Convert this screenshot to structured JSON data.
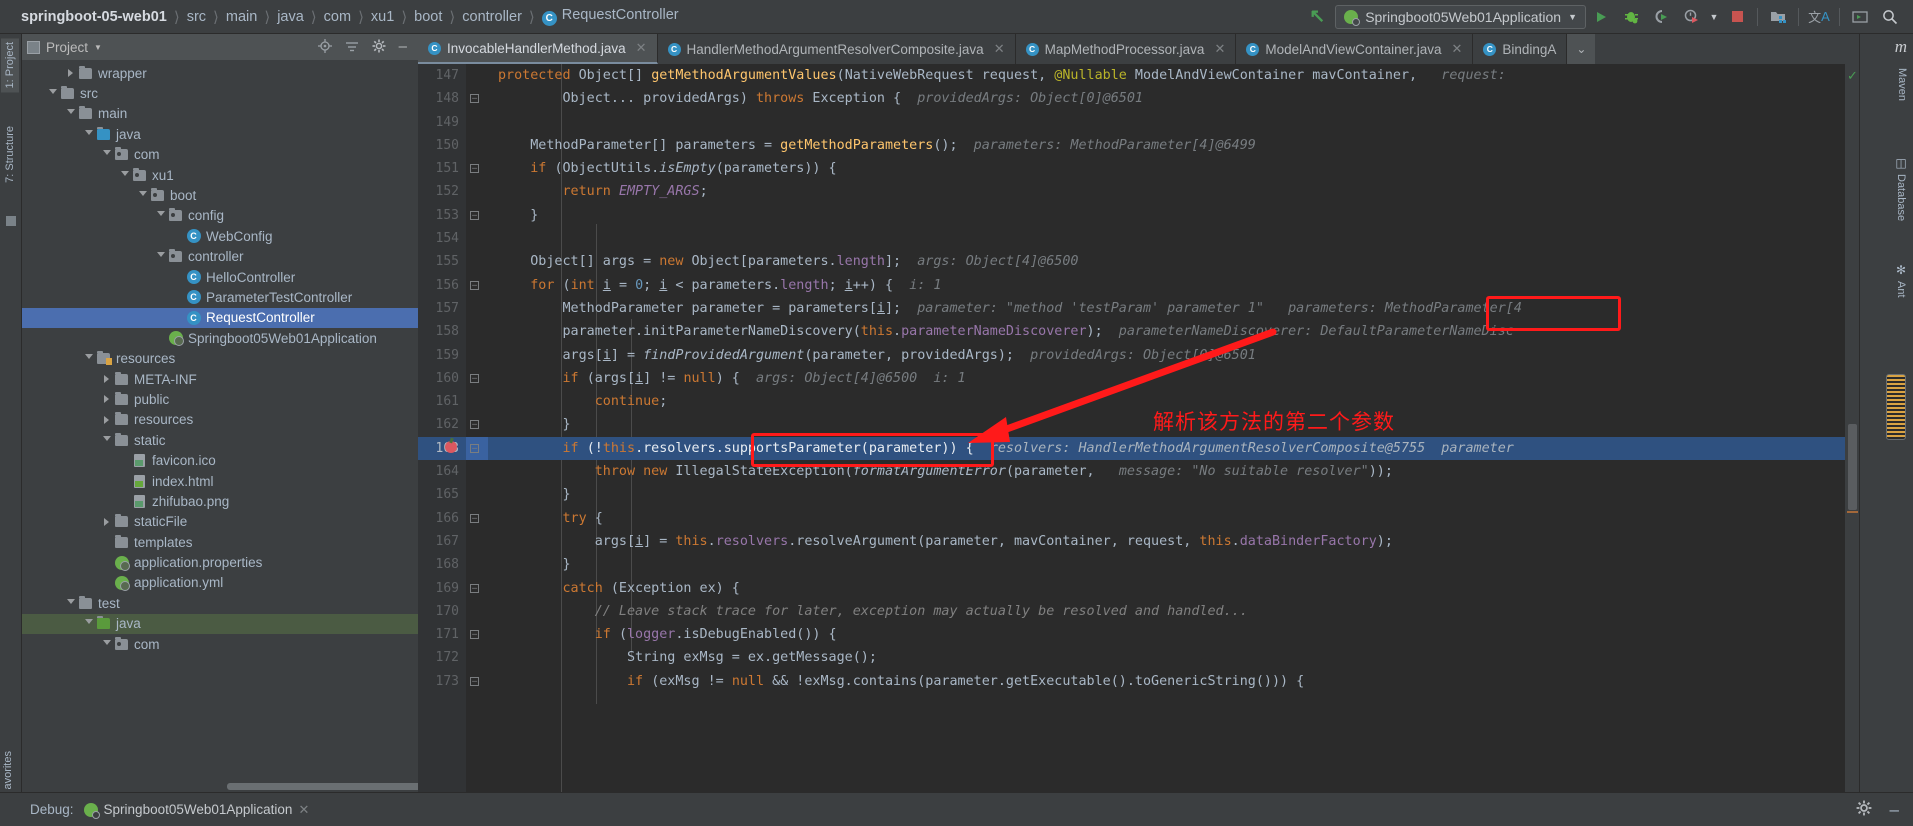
{
  "breadcrumb": {
    "project": "springboot-05-web01",
    "items": [
      "src",
      "main",
      "java",
      "com",
      "xu1",
      "boot",
      "controller"
    ],
    "final_class": "RequestController",
    "class_icon": "C"
  },
  "toolbar": {
    "back_arrow_icon": "arrow-up-left-green",
    "run_config": "Springboot05Web01Application",
    "run_config_icon": "spring-boot-icon",
    "dropdown_icon": "chevron-down-icon",
    "buttons": [
      {
        "name": "run-button",
        "icon": "play-triangle-green"
      },
      {
        "name": "debug-button",
        "icon": "bug-green"
      },
      {
        "name": "run-coverage-button",
        "icon": "coverage-icon"
      },
      {
        "name": "profiler-button",
        "icon": "clock-run-icon"
      },
      {
        "name": "profiler-dropdown",
        "icon": "chevron-down-icon"
      },
      {
        "name": "stop-button",
        "icon": "stop-square-red"
      },
      {
        "name": "project-structure-button",
        "icon": "module-icon"
      },
      {
        "name": "translate-button",
        "icon": "translate-icon"
      },
      {
        "name": "terminal-button",
        "icon": "terminal-icon"
      },
      {
        "name": "search-everywhere-button",
        "icon": "search-icon"
      }
    ]
  },
  "left_tool_strip": [
    {
      "label": "1: Project",
      "selected": true
    },
    {
      "label": "7: Structure",
      "selected": false
    }
  ],
  "project_panel": {
    "title": "Project",
    "dropdown_icon": "chevron-down-icon",
    "header_icons": [
      "locate-icon",
      "collapse-all-icon",
      "settings-gear-icon",
      "hide-icon"
    ],
    "tree": [
      {
        "label": "wrapper",
        "depth": 2,
        "arrow": "closed",
        "icon": "folder"
      },
      {
        "label": "src",
        "depth": 1,
        "arrow": "open",
        "icon": "folder"
      },
      {
        "label": "main",
        "depth": 2,
        "arrow": "open",
        "icon": "folder"
      },
      {
        "label": "java",
        "depth": 3,
        "arrow": "open",
        "icon": "folder-source"
      },
      {
        "label": "com",
        "depth": 4,
        "arrow": "open",
        "icon": "folder-package"
      },
      {
        "label": "xu1",
        "depth": 5,
        "arrow": "open",
        "icon": "folder-package"
      },
      {
        "label": "boot",
        "depth": 6,
        "arrow": "open",
        "icon": "folder-package"
      },
      {
        "label": "config",
        "depth": 7,
        "arrow": "open",
        "icon": "folder-package"
      },
      {
        "label": "WebConfig",
        "depth": 8,
        "arrow": "none",
        "icon": "class"
      },
      {
        "label": "controller",
        "depth": 7,
        "arrow": "open",
        "icon": "folder-package"
      },
      {
        "label": "HelloController",
        "depth": 8,
        "arrow": "none",
        "icon": "class"
      },
      {
        "label": "ParameterTestController",
        "depth": 8,
        "arrow": "none",
        "icon": "class"
      },
      {
        "label": "RequestController",
        "depth": 8,
        "arrow": "none",
        "icon": "class",
        "selected": true
      },
      {
        "label": "Springboot05Web01Application",
        "depth": 7,
        "arrow": "none",
        "icon": "spring-class"
      },
      {
        "label": "resources",
        "depth": 3,
        "arrow": "open",
        "icon": "folder-resource"
      },
      {
        "label": "META-INF",
        "depth": 4,
        "arrow": "closed",
        "icon": "folder"
      },
      {
        "label": "public",
        "depth": 4,
        "arrow": "closed",
        "icon": "folder"
      },
      {
        "label": "resources",
        "depth": 4,
        "arrow": "closed",
        "icon": "folder"
      },
      {
        "label": "static",
        "depth": 4,
        "arrow": "open",
        "icon": "folder"
      },
      {
        "label": "favicon.ico",
        "depth": 5,
        "arrow": "none",
        "icon": "image-file"
      },
      {
        "label": "index.html",
        "depth": 5,
        "arrow": "none",
        "icon": "html-file"
      },
      {
        "label": "zhifubao.png",
        "depth": 5,
        "arrow": "none",
        "icon": "image-file"
      },
      {
        "label": "staticFile",
        "depth": 4,
        "arrow": "closed",
        "icon": "folder"
      },
      {
        "label": "templates",
        "depth": 4,
        "arrow": "none",
        "icon": "folder"
      },
      {
        "label": "application.properties",
        "depth": 4,
        "arrow": "none",
        "icon": "spring-config"
      },
      {
        "label": "application.yml",
        "depth": 4,
        "arrow": "none",
        "icon": "spring-config"
      },
      {
        "label": "test",
        "depth": 2,
        "arrow": "open",
        "icon": "folder"
      },
      {
        "label": "java",
        "depth": 3,
        "arrow": "open",
        "icon": "folder-test-source",
        "highlight": true
      },
      {
        "label": "com",
        "depth": 4,
        "arrow": "open",
        "icon": "folder-package"
      }
    ]
  },
  "editor_tabs": [
    {
      "label": "InvocableHandlerMethod.java",
      "active": true,
      "icon": "class",
      "close_icon": "close-icon"
    },
    {
      "label": "HandlerMethodArgumentResolverComposite.java",
      "active": false,
      "icon": "class",
      "close_icon": "close-icon"
    },
    {
      "label": "MapMethodProcessor.java",
      "active": false,
      "icon": "class",
      "close_icon": "close-icon"
    },
    {
      "label": "ModelAndViewContainer.java",
      "active": false,
      "icon": "class",
      "close_icon": "close-icon"
    },
    {
      "label": "BindingA",
      "active": false,
      "icon": "class",
      "close_icon": ""
    }
  ],
  "tabs_overflow_icon": "chevron-down-icon",
  "code": {
    "lines": [
      {
        "num": "147",
        "fold": "",
        "html": "<span class='kw'>protected</span> <span class='pl'>Object[] </span><span class='mth'>getMethodArgumentValues</span><span class='pl'>(</span><span class='pl'>NativeWebRequest request</span><span class='pl'>, </span><span class='ann'>@Nullable</span> <span class='pl'>ModelAndViewContainer mavContainer</span><span class='pl'>,</span>   <span class='hint'>request:</span>"
      },
      {
        "num": "148",
        "fold": "-",
        "html": "        <span class='pl'>Object... providedArgs) </span><span class='kw'>throws</span> <span class='pl'>Exception {</span>  <span class='hint'>providedArgs: Object[0]@6501</span>"
      },
      {
        "num": "149",
        "fold": "",
        "html": ""
      },
      {
        "num": "150",
        "fold": "",
        "html": "    <span class='pl'>MethodParameter[] parameters = </span><span class='mth'>getMethodParameters</span><span class='pl'>();</span>  <span class='hint'>parameters: MethodParameter[4]@6499</span>"
      },
      {
        "num": "151",
        "fold": "-",
        "html": "    <span class='kw'>if</span> <span class='pl'>(ObjectUtils.</span><span class='ital pl'>isEmpty</span><span class='pl'>(parameters)) {</span>"
      },
      {
        "num": "152",
        "fold": "",
        "html": "        <span class='kw'>return</span> <span class='ital fld2'>EMPTY_ARGS</span><span class='pl'>;</span>"
      },
      {
        "num": "153",
        "fold": "+",
        "html": "    <span class='pl'>}</span>"
      },
      {
        "num": "154",
        "fold": "",
        "html": ""
      },
      {
        "num": "155",
        "fold": "",
        "html": "    <span class='pl'>Object[] args = </span><span class='kw'>new</span> <span class='pl'>Object[parameters.</span><span class='fld2'>length</span><span class='pl'>];</span>  <span class='hint'>args: Object[4]@6500</span>"
      },
      {
        "num": "156",
        "fold": "-",
        "html": "    <span class='kw'>for</span> <span class='pl'>(</span><span class='kw'>int</span> <span class='var'>i</span> <span class='pl'>= </span><span class='num'>0</span><span class='pl'>; </span><span class='var'>i</span><span class='pl'> &lt; parameters.</span><span class='fld2'>length</span><span class='pl'>; </span><span class='var'>i</span><span class='pl'>++) {</span>  <span class='hint'>i: 1</span>"
      },
      {
        "num": "157",
        "fold": "",
        "html": "        <span class='pl'>MethodParameter parameter = parameters[</span><span class='var'>i</span><span class='pl'>];</span>  <span class='hint'>parameter: \"method 'testParam' parameter 1\"</span>   <span class='hint'>parameters: MethodParameter[4</span>"
      },
      {
        "num": "158",
        "fold": "",
        "html": "        <span class='pl'>parameter.</span><span class='mth2 pl'>initParameterNameDiscovery</span><span class='pl'>(</span><span class='kw'>this</span><span class='pl'>.</span><span class='fld2'>parameterNameDiscoverer</span><span class='pl'>);</span>  <span class='hint'>parameterNameDiscoverer: DefaultParameterNameDisc</span>"
      },
      {
        "num": "159",
        "fold": "",
        "html": "        <span class='pl'>args[</span><span class='var'>i</span><span class='pl'>] = </span><span class='ital pl'>findProvidedArgument</span><span class='pl'>(parameter, providedArgs);</span>  <span class='hint'>providedArgs: Object[0]@6501</span>"
      },
      {
        "num": "160",
        "fold": "-",
        "html": "        <span class='kw'>if</span> <span class='pl'>(args[</span><span class='var'>i</span><span class='pl'>] != </span><span class='kw'>null</span><span class='pl'>) {</span>  <span class='hint'>args: Object[4]@6500  i: 1</span>"
      },
      {
        "num": "161",
        "fold": "",
        "html": "            <span class='kw'>continue</span><span class='pl'>;</span>"
      },
      {
        "num": "162",
        "fold": "+",
        "html": "        <span class='pl'>}</span>"
      },
      {
        "num": "163",
        "fold": "-",
        "hl": true,
        "bp": true,
        "html": "        <span class='kw'>if</span> <span class='pl'>(!</span><span class='kw'>this</span><span class='pl'>.</span><span class='fld2'>resolvers</span><span class='pl'>.supportsParameter(parameter)) {</span>  <span class='hint'>resolvers: HandlerMethodArgumentResolverComposite@5755</span>  <span class='hint'>parameter</span>"
      },
      {
        "num": "164",
        "fold": "",
        "html": "            <span class='kw'>throw new</span> <span class='pl'>IllegalStateException(</span><span class='ital pl'>formatArgumentError</span><span class='pl'>(parameter, </span>  <span class='hint'>message: \"No suitable resolver\"</span><span class='pl'>));</span>"
      },
      {
        "num": "165",
        "fold": "",
        "html": "        <span class='pl'>}</span>"
      },
      {
        "num": "166",
        "fold": "-",
        "html": "        <span class='kw'>try</span> <span class='pl'>{</span>"
      },
      {
        "num": "167",
        "fold": "",
        "html": "            <span class='pl'>args[</span><span class='var'>i</span><span class='pl'>] = </span><span class='kw'>this</span><span class='pl'>.</span><span class='fld2'>resolvers</span><span class='pl'>.resolveArgument(parameter, mavContainer, request, </span><span class='kw'>this</span><span class='pl'>.</span><span class='fld2'>dataBinderFactory</span><span class='pl'>);</span>"
      },
      {
        "num": "168",
        "fold": "",
        "html": "        <span class='pl'>}</span>"
      },
      {
        "num": "169",
        "fold": "-",
        "html": "        <span class='kw'>catch</span> <span class='pl'>(Exception ex) {</span>"
      },
      {
        "num": "170",
        "fold": "",
        "html": "            <span class='cmt'>// Leave stack trace for later, exception may actually be resolved and handled...</span>"
      },
      {
        "num": "171",
        "fold": "-",
        "html": "            <span class='kw'>if</span> <span class='pl'>(</span><span class='fld2'>logger</span><span class='pl'>.isDebugEnabled()) {</span>"
      },
      {
        "num": "172",
        "fold": "",
        "html": "                <span class='pl'>String exMsg = ex.getMessage();</span>"
      },
      {
        "num": "173",
        "fold": "-",
        "html": "                <span class='kw'>if</span> <span class='pl'>(exMsg != </span><span class='kw'>null</span> <span class='pl'>&amp;&amp; !exMsg.contains(parameter.getExecutable().toGenericString())) {</span>"
      }
    ]
  },
  "annotations": {
    "box1_label": "parameter 1",
    "box2_label": "supportsParameter(parameter)",
    "chinese_note": "解析该方法的第二个参数",
    "arrow_color": "#ff1a1a",
    "box_color": "#ff1a1a"
  },
  "right_tool_strip": [
    {
      "label": "Maven",
      "icon": "maven-icon"
    },
    {
      "label": "Database",
      "icon": "database-icon"
    },
    {
      "label": "Ant",
      "icon": "ant-icon"
    }
  ],
  "right_m_logo": "m",
  "status_bar": {
    "debug_label": "Debug:",
    "debug_session": "Springboot05Web01Application",
    "session_icon": "spring-boot-icon",
    "close_icon": "close-icon",
    "settings_icon": "gear-icon",
    "hide_icon": "minimize-icon"
  },
  "favorites_label": "avorites",
  "colors": {
    "accent_blue": "#4b6eaf",
    "annotation_red": "#ff1a1a",
    "editor_bg": "#2b2b2b",
    "panel_bg": "#3c3f41",
    "keyword_orange": "#cc7832",
    "method_yellow": "#ffc66d",
    "field_purple": "#9876aa",
    "string_green": "#6a8759"
  }
}
